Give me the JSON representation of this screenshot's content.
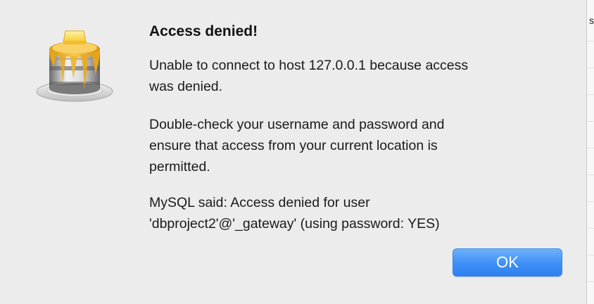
{
  "dialog": {
    "title": "Access denied!",
    "message_1": "Unable to connect to host 127.0.0.1 because access\nwas denied.",
    "message_2": "Double-check your username and password and\nensure that access from your current location is\npermitted.",
    "message_3": "MySQL said: Access denied for user\n'dbproject2'@'_gateway' (using password: YES)",
    "ok_label": "OK",
    "icon": "sequel-pro-pancake-icon"
  },
  "background_window": {
    "visible_char": "s"
  },
  "colors": {
    "dialog_bg": "#ececec",
    "button_blue": "#3d8ff5",
    "button_text": "#ffffff",
    "syrup_gold": "#f0b429",
    "butter": "#ffd640"
  }
}
